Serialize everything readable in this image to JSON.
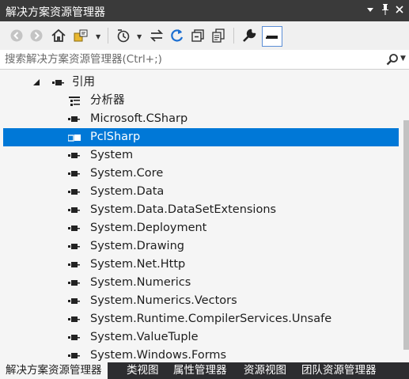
{
  "window": {
    "title": "解决方案资源管理器",
    "dropdown_icon": "chevron-down-icon",
    "pin_icon": "pin-icon",
    "close_icon": "close-icon"
  },
  "toolbar": {
    "icons": [
      "back-icon",
      "forward-icon",
      "home-icon",
      "switch-views-icon",
      "pending-changes-icon",
      "sync-icon",
      "refresh-icon",
      "collapse-all-icon",
      "show-all-files-icon",
      "properties-wrench-icon",
      "preview-icon"
    ]
  },
  "search": {
    "placeholder": "搜索解决方案资源管理器(Ctrl+;)",
    "value": ""
  },
  "tree": {
    "root": {
      "label": "引用",
      "expanded": true
    },
    "items": [
      {
        "label": "分析器",
        "icon": "analyzer-icon"
      },
      {
        "label": "Microsoft.CSharp",
        "icon": "reference-icon"
      },
      {
        "label": "PclSharp",
        "icon": "reference-icon",
        "selected": true
      },
      {
        "label": "System",
        "icon": "reference-icon"
      },
      {
        "label": "System.Core",
        "icon": "reference-icon"
      },
      {
        "label": "System.Data",
        "icon": "reference-icon"
      },
      {
        "label": "System.Data.DataSetExtensions",
        "icon": "reference-icon"
      },
      {
        "label": "System.Deployment",
        "icon": "reference-icon"
      },
      {
        "label": "System.Drawing",
        "icon": "reference-icon"
      },
      {
        "label": "System.Net.Http",
        "icon": "reference-icon"
      },
      {
        "label": "System.Numerics",
        "icon": "reference-icon"
      },
      {
        "label": "System.Numerics.Vectors",
        "icon": "reference-icon"
      },
      {
        "label": "System.Runtime.CompilerServices.Unsafe",
        "icon": "reference-icon"
      },
      {
        "label": "System.ValueTuple",
        "icon": "reference-icon"
      },
      {
        "label": "System.Windows.Forms",
        "icon": "reference-icon"
      }
    ]
  },
  "tabs": [
    {
      "label": "解决方案资源管理器",
      "active": true
    },
    {
      "label": "类视图"
    },
    {
      "label": "属性管理器"
    },
    {
      "label": "资源视图"
    },
    {
      "label": "团队资源管理器"
    }
  ],
  "colors": {
    "title_bar": "#3a3a3a",
    "selection": "#0078d7",
    "tab_bar": "#2d2d30",
    "background": "#f5f5f5"
  }
}
